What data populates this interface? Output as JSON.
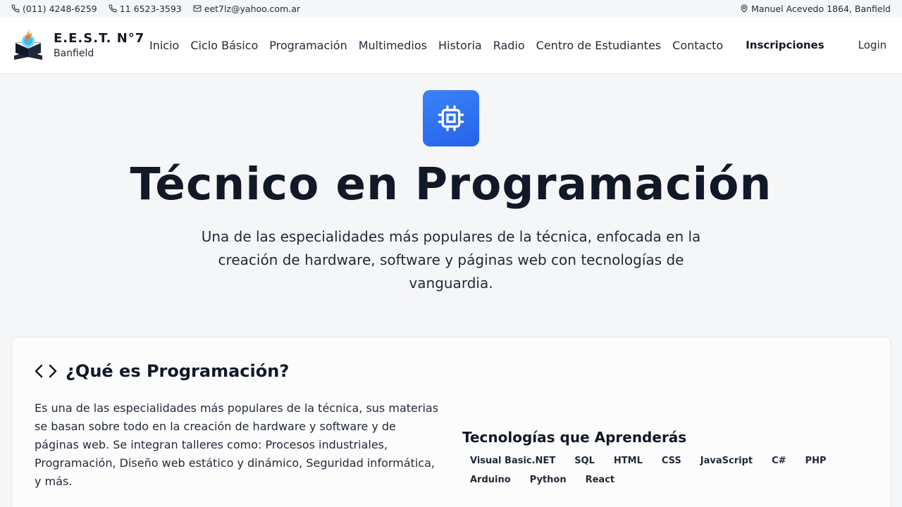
{
  "topbar": {
    "phone1": "(011) 4248-6259",
    "phone2": "11 6523-3593",
    "email": "eet7lz@yahoo.com.ar",
    "address": "Manuel Acevedo 1864, Banfield"
  },
  "brand": {
    "name": "E.E.S.T. N°7",
    "city": "Banfield"
  },
  "nav": {
    "items": [
      "Inicio",
      "Ciclo Básico",
      "Programación",
      "Multimedios",
      "Historia",
      "Radio",
      "Centro de Estudiantes",
      "Contacto"
    ],
    "cta": "Inscripciones",
    "login": "Login"
  },
  "hero": {
    "title": "Técnico en Programación",
    "subtitle": "Una de las especialidades más populares de la técnica, enfocada en la creación de hardware, software y páginas web con tecnologías de vanguardia.",
    "icon": "cpu-icon",
    "accent": "#2563eb"
  },
  "section": {
    "title": "¿Qué es Programación?",
    "icon": "code-icon",
    "text": "Es una de las especialidades más populares de la técnica, sus materias se basan sobre todo en la creación de hardware y software y de páginas web. Se integran talleres como: Procesos industriales, Programación, Diseño web estático y dinámico, Seguridad informática, y más."
  },
  "tech": {
    "title": "Tecnologías que Aprenderás",
    "tags": [
      "Visual Basic.NET",
      "SQL",
      "HTML",
      "CSS",
      "JavaScript",
      "C#",
      "PHP",
      "Arduino",
      "Python",
      "React"
    ]
  }
}
